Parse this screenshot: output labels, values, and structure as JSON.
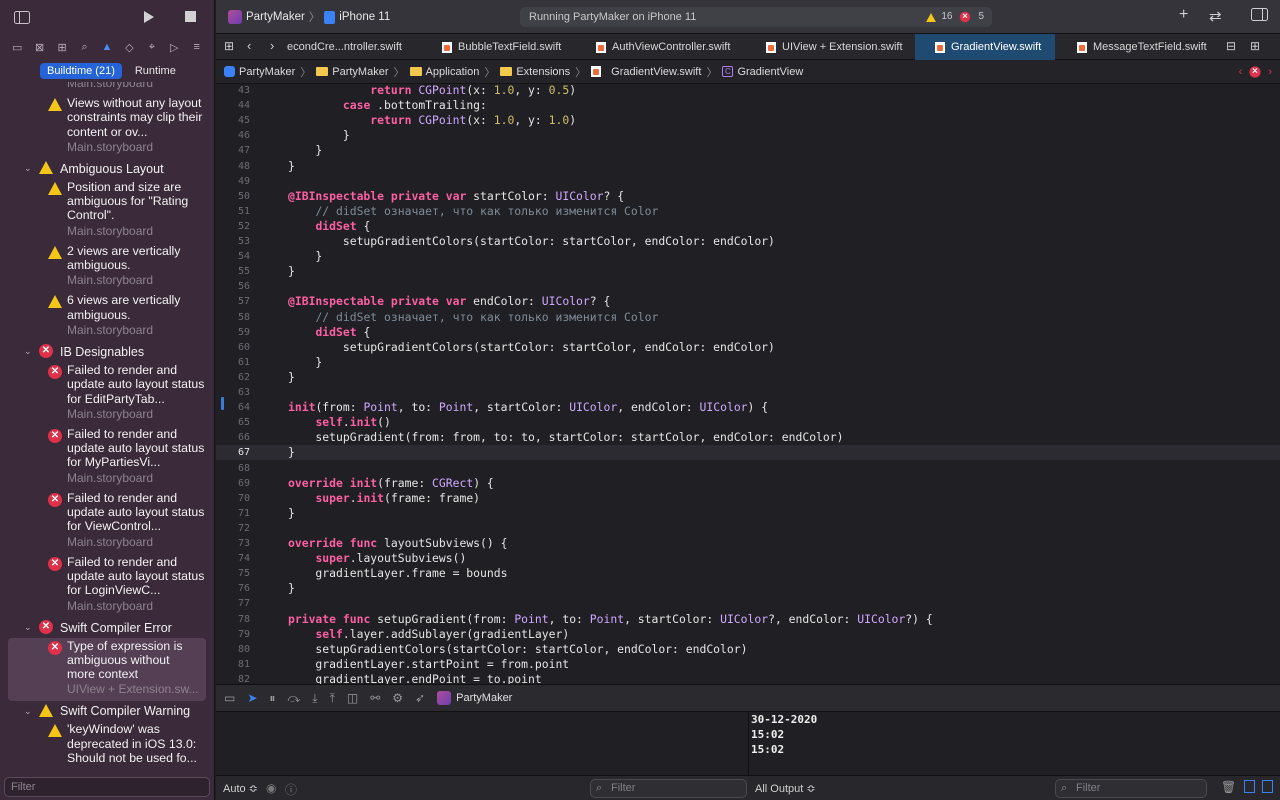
{
  "toolbar": {
    "project": "PartyMaker",
    "device": "iPhone 11",
    "status": "Running PartyMaker on iPhone 11",
    "warnings": "16",
    "errors": "5"
  },
  "navigator": {
    "segments": [
      "Buildtime (21)",
      "Runtime"
    ],
    "filter_placeholder": "Filter",
    "items": [
      {
        "kind": "src",
        "text": "Main.storyboard"
      },
      {
        "kind": "warn",
        "msg": "Views without any layout constraints may clip their content or ov...",
        "src": "Main.storyboard"
      },
      {
        "kind": "group-warn",
        "text": "Ambiguous Layout"
      },
      {
        "kind": "warn",
        "msg": "Position and size are ambiguous for \"Rating Control\".",
        "src": "Main.storyboard"
      },
      {
        "kind": "warn",
        "msg": "2 views are vertically ambiguous.",
        "src": "Main.storyboard"
      },
      {
        "kind": "warn",
        "msg": "6 views are vertically ambiguous.",
        "src": "Main.storyboard"
      },
      {
        "kind": "group-err",
        "text": "IB Designables"
      },
      {
        "kind": "err",
        "msg": "Failed to render and update auto layout status for EditPartyTab...",
        "src": "Main.storyboard"
      },
      {
        "kind": "err",
        "msg": "Failed to render and update auto layout status for MyPartiesVi...",
        "src": "Main.storyboard"
      },
      {
        "kind": "err",
        "msg": "Failed to render and update auto layout status for ViewControl...",
        "src": "Main.storyboard"
      },
      {
        "kind": "err",
        "msg": "Failed to render and update auto layout status for LoginViewC...",
        "src": "Main.storyboard"
      },
      {
        "kind": "group-err",
        "text": "Swift Compiler Error"
      },
      {
        "kind": "err-selected",
        "msg": "Type of expression is ambiguous without more context",
        "src": "UIView + Extension.sw..."
      },
      {
        "kind": "group-warn",
        "text": "Swift Compiler Warning"
      },
      {
        "kind": "warn",
        "msg": "'keyWindow' was deprecated in iOS 13.0: Should not be used fo...",
        "src": ""
      }
    ]
  },
  "tabs": [
    "econdCre...ntroller.swift",
    "BubbleTextField.swift",
    "AuthViewController.swift",
    "UIView + Extension.swift",
    "GradientView.swift",
    "MessageTextField.swift"
  ],
  "breadcrumb": [
    "PartyMaker",
    "PartyMaker",
    "Application",
    "Extensions",
    "GradientView.swift",
    "GradientView"
  ],
  "editor": {
    "lines": [
      {
        "n": "43",
        "code": "            return CGPoint(x: 1.0, y: 0.5)"
      },
      {
        "n": "44",
        "code": "        case .bottomTrailing:"
      },
      {
        "n": "45",
        "code": "            return CGPoint(x: 1.0, y: 1.0)"
      },
      {
        "n": "46",
        "code": "        }"
      },
      {
        "n": "47",
        "code": "    }"
      },
      {
        "n": "48",
        "code": "}"
      },
      {
        "n": "49",
        "code": ""
      },
      {
        "n": "50",
        "code": "@IBInspectable private var startColor: UIColor? {"
      },
      {
        "n": "51",
        "code": "    // didSet означает, что как только изменится Color"
      },
      {
        "n": "52",
        "code": "    didSet {"
      },
      {
        "n": "53",
        "code": "        setupGradientColors(startColor: startColor, endColor: endColor)"
      },
      {
        "n": "54",
        "code": "    }"
      },
      {
        "n": "55",
        "code": "}"
      },
      {
        "n": "56",
        "code": ""
      },
      {
        "n": "57",
        "code": "@IBInspectable private var endColor: UIColor? {"
      },
      {
        "n": "58",
        "code": "    // didSet означает, что как только изменится Color"
      },
      {
        "n": "59",
        "code": "    didSet {"
      },
      {
        "n": "60",
        "code": "        setupGradientColors(startColor: startColor, endColor: endColor)"
      },
      {
        "n": "61",
        "code": "    }"
      },
      {
        "n": "62",
        "code": "}"
      },
      {
        "n": "63",
        "code": ""
      },
      {
        "n": "64",
        "code": "init(from: Point, to: Point, startColor: UIColor, endColor: UIColor) {"
      },
      {
        "n": "65",
        "code": "    self.init()"
      },
      {
        "n": "66",
        "code": "    setupGradient(from: from, to: to, startColor: startColor, endColor: endColor)"
      },
      {
        "n": "67",
        "code": "}"
      },
      {
        "n": "68",
        "code": ""
      },
      {
        "n": "69",
        "code": "override init(frame: CGRect) {"
      },
      {
        "n": "70",
        "code": "    super.init(frame: frame)"
      },
      {
        "n": "71",
        "code": "}"
      },
      {
        "n": "72",
        "code": ""
      },
      {
        "n": "73",
        "code": "override func layoutSubviews() {"
      },
      {
        "n": "74",
        "code": "    super.layoutSubviews()"
      },
      {
        "n": "75",
        "code": "    gradientLayer.frame = bounds"
      },
      {
        "n": "76",
        "code": "}"
      },
      {
        "n": "77",
        "code": ""
      },
      {
        "n": "78",
        "code": "private func setupGradient(from: Point, to: Point, startColor: UIColor?, endColor: UIColor?) {"
      },
      {
        "n": "79",
        "code": "    self.layer.addSublayer(gradientLayer)"
      },
      {
        "n": "80",
        "code": "    setupGradientColors(startColor: startColor, endColor: endColor)"
      },
      {
        "n": "81",
        "code": "    gradientLayer.startPoint = from.point"
      },
      {
        "n": "82",
        "code": "    gradientLayer.endPoint = to.point"
      }
    ],
    "current_line": "67"
  },
  "debug": {
    "target": "PartyMaker"
  },
  "console": {
    "lines": [
      "30-12-2020",
      "15:02",
      "15:02"
    ],
    "scope": "Auto ≎",
    "output": "All Output ≎",
    "filter_placeholder": "Filter"
  }
}
